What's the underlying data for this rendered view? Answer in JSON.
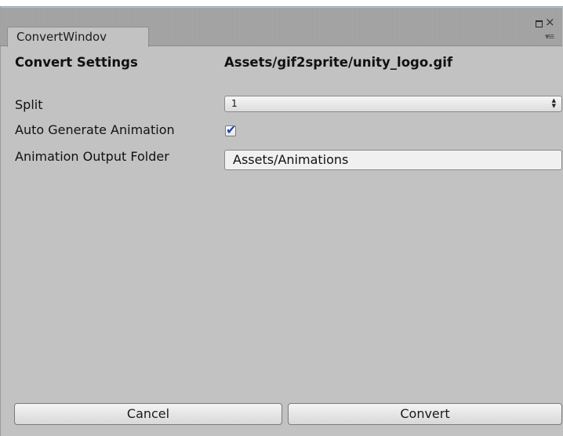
{
  "window": {
    "tab_title": "ConvertWindov",
    "close_glyph": "×",
    "menu_glyph": "▾≡"
  },
  "settings": {
    "heading": "Convert Settings",
    "asset_path": "Assets/gif2sprite/unity_logo.gif"
  },
  "fields": {
    "split_label": "Split",
    "split_value": "1",
    "split_arrow": "▲▼",
    "auto_generate_label": "Auto Generate Animation",
    "auto_generate_checked": true,
    "check_glyph": "✔",
    "output_folder_label": "Animation Output Folder",
    "output_folder_value": "Assets/Animations"
  },
  "buttons": {
    "cancel": "Cancel",
    "convert": "Convert"
  },
  "colors": {
    "window_bg": "#c2c2c2",
    "tabbar_bg": "#a8a8a8",
    "check_color": "#1e44b8"
  }
}
